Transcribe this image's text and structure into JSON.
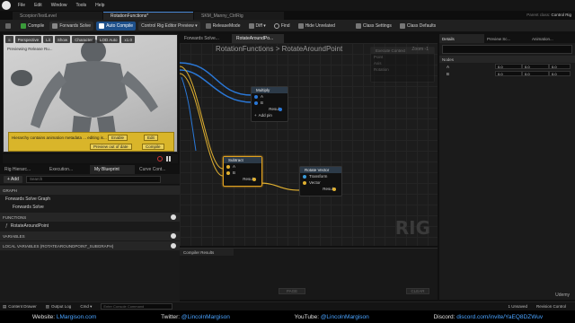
{
  "menubar": {
    "items": [
      "File",
      "Edit",
      "Window",
      "Tools",
      "Help"
    ]
  },
  "tabs": [
    {
      "label": "ScorpionTestLevel"
    },
    {
      "label": "RotationFunctions*"
    },
    {
      "label": "SKM_Manny_CtrlRig"
    }
  ],
  "parent": {
    "label": "Parent class:",
    "value": "Control Rig"
  },
  "toolbar": {
    "compile": "Compile",
    "forwards_solve": "Forwards Solve",
    "auto_compile": "Auto Compile",
    "preview": "Control Rig Editor Preview",
    "release_mode": "ReleaseMode",
    "diff": "Diff",
    "find": "Find",
    "hide_unrelated": "Hide Unrelated",
    "class_settings": "Class Settings",
    "class_defaults": "Class Defaults"
  },
  "viewport": {
    "buttons": [
      "Perspective",
      "Lit",
      "Show",
      "Character",
      "LOD Auto",
      "x1.0"
    ],
    "overlay_text": "Previewing Release Ru...",
    "message": "Hierarchy contains animation metadata ... editing is...",
    "buttons2": [
      "Enable",
      "Edit",
      "Preview out of date",
      "Compile"
    ]
  },
  "left_panel": {
    "tabs": [
      "Rig Hierarc...",
      "Execution...",
      "My Blueprint",
      "Curve Cont..."
    ],
    "add": "+ Add",
    "search_placeholder": "Search",
    "sections": {
      "graph": "GRAPH",
      "functions": "FUNCTIONS",
      "variables": "VARIABLES",
      "local_vars": "LOCAL VARIABLES (ROTATEAROUNDPOINT_SUBGRAPH)"
    },
    "graph_items": [
      "Forwards Solve Graph",
      "Forwards Solve"
    ],
    "function_items": [
      "RotateAroundPoint"
    ]
  },
  "graph": {
    "tabs": [
      "Forwards Solve...",
      "RotateAroundPo..."
    ],
    "breadcrumb": "RotationFunctions  >  RotateAroundPoint",
    "zoom": "Zoom -1",
    "watermark": "RIG",
    "nodes": {
      "entry": {
        "title": "Execute Context",
        "pins": [
          "Point",
          "Axis",
          "Rotation"
        ]
      },
      "multiply": {
        "title": "Multiply",
        "pins": [
          "A",
          "B"
        ],
        "result": "Result",
        "add_pin": "Add pin"
      },
      "subtract": {
        "title": "Subtract",
        "pins": [
          "A",
          "B"
        ],
        "result": "Result"
      },
      "rotate": {
        "title": "Rotate Vector",
        "pins": [
          "Transform",
          "Vector"
        ],
        "result": "Result"
      }
    }
  },
  "compiler": {
    "tab": "Compiler Results",
    "page": "PAGE",
    "clear": "CLEAR"
  },
  "right_panel": {
    "tabs": [
      "Details",
      "Preview Sc...",
      "Animation..."
    ],
    "section": "Nodes",
    "rows": [
      {
        "label": "A",
        "values": [
          "0.0",
          "0.0",
          "0.0"
        ]
      },
      {
        "label": "B",
        "values": [
          "0.0",
          "0.0",
          "0.0"
        ]
      }
    ]
  },
  "statusbar": {
    "content_drawer": "Content Drawer",
    "output_log": "Output Log",
    "cmd": "Cmd",
    "cmd_placeholder": "Enter Console Command",
    "unsaved": "1 Unsaved",
    "revision": "Revision Control"
  },
  "footer": {
    "website_label": "Website:",
    "website": "LMargison.com",
    "twitter_label": "Twitter:",
    "twitter": "@LincolnMargison",
    "youtube_label": "YouTube:",
    "youtube": "@LincolnMargison",
    "discord_label": "Discord:",
    "discord": "discord.com/invite/YaEQ8DZWuv",
    "brand": "Udemy"
  },
  "colors": {
    "accent": "#1d4f8a",
    "graph_bg": "#1c1c1c",
    "selection": "#e0a020",
    "wire_blue": "#2a78d8"
  }
}
